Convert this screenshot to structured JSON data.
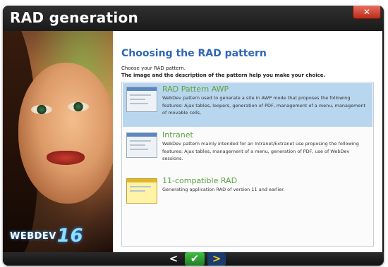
{
  "window": {
    "title": "RAD generation",
    "close_icon": "close-icon"
  },
  "sidebar": {
    "brand": "WEBDEV",
    "brand_version": "16"
  },
  "main": {
    "heading": "Choosing the RAD pattern",
    "intro_line1": "Choose your RAD pattern.",
    "intro_line2": "The image and the description of the pattern help you make your choice.",
    "patterns": [
      {
        "title": "RAD Pattern AWP",
        "description": "WebDev pattern used to generate a site in AWP mode that proposes the following features: Ajax tables, loopers, generation of PDF, management of a menu, management of movable cells,",
        "selected": true,
        "icon": "awp-pattern-thumbnail"
      },
      {
        "title": "Intranet",
        "description": "WebDev pattern mainly intended for an Intranet/Extranet use proposing the following features: Ajax tables, management of a menu, generation of PDF, use of WebDev sessions.",
        "selected": false,
        "icon": "intranet-pattern-thumbnail"
      },
      {
        "title": "11-compatible RAD",
        "description": "Generating application RAD of version 11 and earlier.",
        "selected": false,
        "icon": "compatible-rad-thumbnail"
      }
    ]
  },
  "footer": {
    "prev_glyph": "<",
    "ok_glyph": "✔",
    "next_glyph": ">"
  },
  "colors": {
    "heading": "#2f66b8",
    "item_title": "#5aa23f",
    "selected_bg": "#b9d6ef",
    "ok_button": "#2ea133",
    "next_arrow": "#f5c518"
  }
}
